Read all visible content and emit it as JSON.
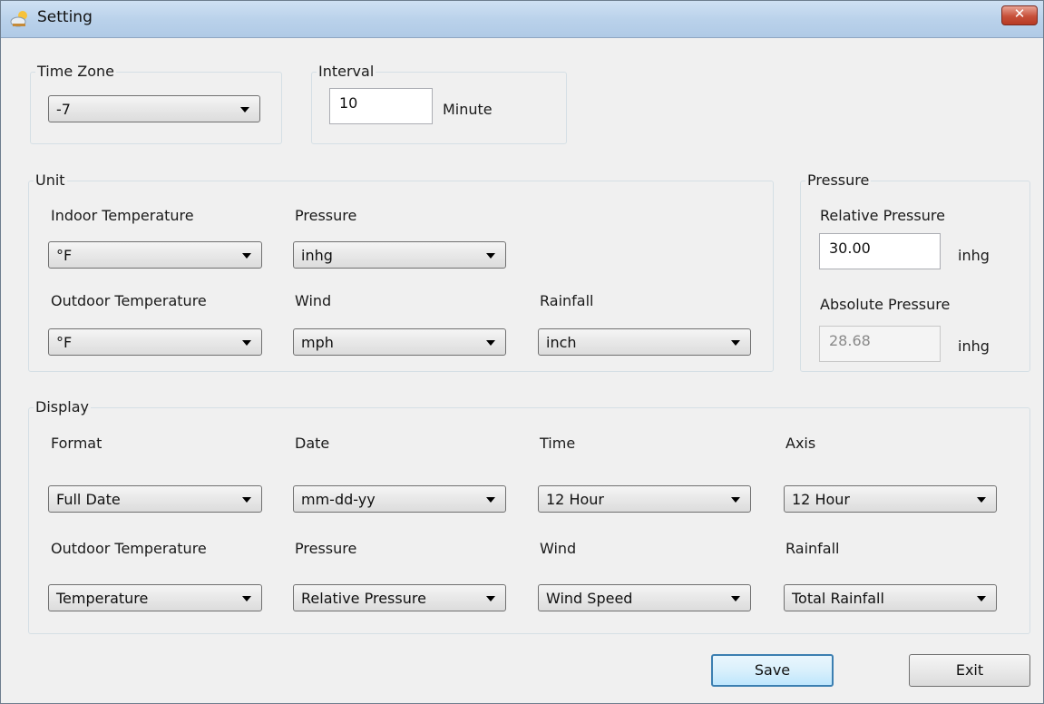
{
  "window": {
    "title": "Setting",
    "close_symbol": "✕",
    "app_icon": "weather-cloud-sun-icon"
  },
  "timezone": {
    "legend": "Time Zone",
    "value": "-7"
  },
  "interval": {
    "legend": "Interval",
    "value": "10",
    "unit": "Minute"
  },
  "unit": {
    "legend": "Unit",
    "indoor_temp": {
      "label": "Indoor Temperature",
      "value": "°F"
    },
    "pressure": {
      "label": "Pressure",
      "value": "inhg"
    },
    "outdoor_temp": {
      "label": "Outdoor Temperature",
      "value": "°F"
    },
    "wind": {
      "label": "Wind",
      "value": "mph"
    },
    "rainfall": {
      "label": "Rainfall",
      "value": "inch"
    }
  },
  "pressure": {
    "legend": "Pressure",
    "relative": {
      "label": "Relative Pressure",
      "value": "30.00",
      "unit": "inhg"
    },
    "absolute": {
      "label": "Absolute Pressure",
      "value": "28.68",
      "unit": "inhg"
    }
  },
  "display": {
    "legend": "Display",
    "format": {
      "label": "Format",
      "value": "Full Date"
    },
    "date": {
      "label": "Date",
      "value": "mm-dd-yy"
    },
    "time": {
      "label": "Time",
      "value": "12 Hour"
    },
    "axis": {
      "label": "Axis",
      "value": "12 Hour"
    },
    "outdoor_temp": {
      "label": "Outdoor Temperature",
      "value": "Temperature"
    },
    "pressure": {
      "label": "Pressure",
      "value": "Relative Pressure"
    },
    "wind": {
      "label": "Wind",
      "value": "Wind Speed"
    },
    "rainfall": {
      "label": "Rainfall",
      "value": "Total Rainfall"
    }
  },
  "buttons": {
    "save": "Save",
    "exit": "Exit"
  },
  "colors": {
    "titlebar": "#b9d1ea",
    "close": "#c7503a",
    "window_bg": "#f0f0f0",
    "default_button_border": "#3c7fb1"
  }
}
